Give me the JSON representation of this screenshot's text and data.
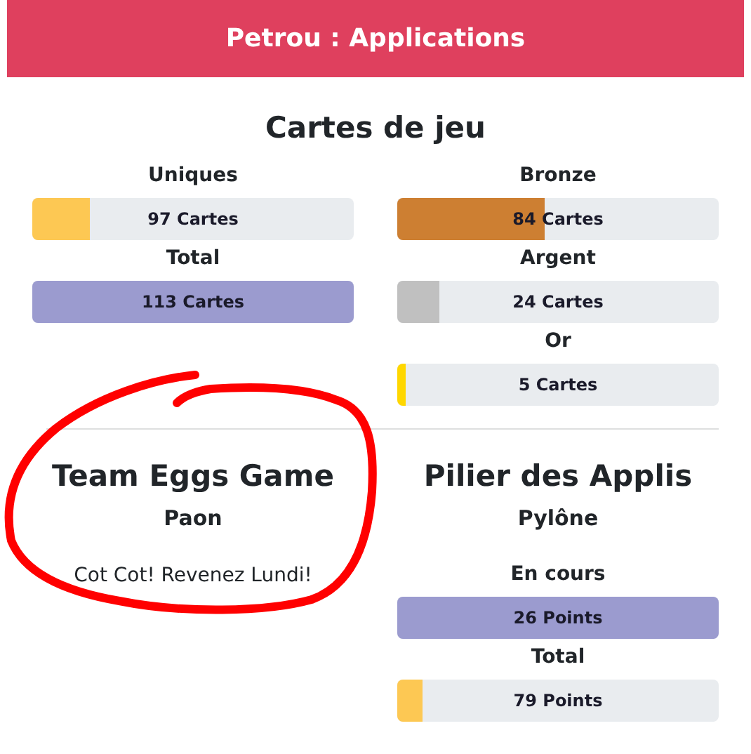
{
  "header": {
    "title": "Petrou : Applications"
  },
  "cards_section": {
    "title": "Cartes de jeu",
    "columns": [
      [
        {
          "label": "Uniques",
          "reading": "97 Cartes",
          "level": 0.18,
          "color": "#fdc853"
        },
        {
          "label": "Total",
          "reading": "113 Cartes",
          "level": 1,
          "color": "#9b9bcf"
        }
      ],
      [
        {
          "label": "Bronze",
          "reading": "84 Cartes",
          "level": 0.46,
          "color": "#cd7f32"
        },
        {
          "label": "Argent",
          "reading": "24 Cartes",
          "level": 0.13,
          "color": "#c0c0c0"
        },
        {
          "label": "Or",
          "reading": "5 Cartes",
          "level": 0.025,
          "color": "#ffd700"
        }
      ]
    ]
  },
  "apps": [
    {
      "title": "Team Eggs Game",
      "subtitle": "Paon",
      "message": "Cot Cot! Revenez Lundi!"
    },
    {
      "title": "Pilier des Applis",
      "subtitle": "Pylône",
      "meters": [
        {
          "label": "En cours",
          "reading": "26 Points",
          "level": 1,
          "color": "#9b9bcf"
        },
        {
          "label": "Total",
          "reading": "79 Points",
          "level": 0.08,
          "color": "#fdc853"
        }
      ]
    }
  ],
  "annotations": [
    {
      "kind": "freehand-circle"
    }
  ]
}
